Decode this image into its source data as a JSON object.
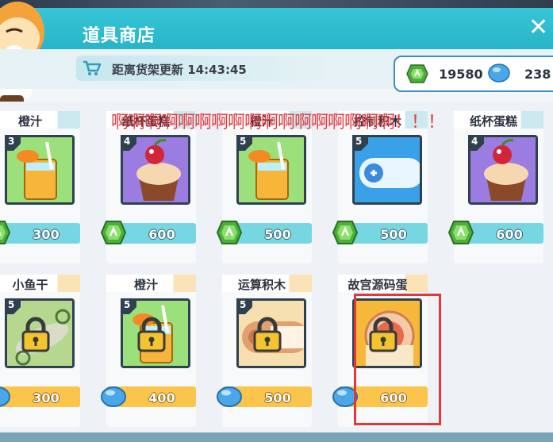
{
  "header": {
    "title": "道具商店",
    "refresh_label": "距离货架更新 14:43:45",
    "close_label": "✕"
  },
  "currency": {
    "gem_value": "19580",
    "shell_value": "238"
  },
  "overlay": {
    "text": "啊啊啊啊啊啊啊啊啊啊啊啊啊啊啊啊啊！！！"
  },
  "items": [
    {
      "name": "橙汁",
      "level": "3",
      "price": "300",
      "currency": "gem",
      "locked": false,
      "art": "juice"
    },
    {
      "name": "纸杯蛋糕",
      "level": "4",
      "price": "600",
      "currency": "gem",
      "locked": false,
      "art": "cupcake"
    },
    {
      "name": "橙汁",
      "level": "5",
      "price": "500",
      "currency": "gem",
      "locked": false,
      "art": "juice"
    },
    {
      "name": "控制积木",
      "level": "5",
      "price": "500",
      "currency": "gem",
      "locked": false,
      "art": "controller"
    },
    {
      "name": "纸杯蛋糕",
      "level": "4",
      "price": "600",
      "currency": "gem",
      "locked": false,
      "art": "cupcake"
    },
    {
      "name": "小鱼干",
      "level": "5",
      "price": "300",
      "currency": "shell",
      "locked": true,
      "art": "fish"
    },
    {
      "name": "橙汁",
      "level": "5",
      "price": "400",
      "currency": "shell",
      "locked": true,
      "art": "juice"
    },
    {
      "name": "运算积木",
      "level": "5",
      "price": "500",
      "currency": "shell",
      "locked": true,
      "art": "operator"
    },
    {
      "name": "故宫源码蛋",
      "level": "",
      "price": "600",
      "currency": "shell",
      "locked": true,
      "art": "egg"
    }
  ],
  "colors": {
    "header": "#2fbdd0",
    "price_unlocked": "#76d7e2",
    "price_locked": "#fbc44a",
    "highlight": "#e2383a",
    "overlay_text": "#e8393c"
  }
}
